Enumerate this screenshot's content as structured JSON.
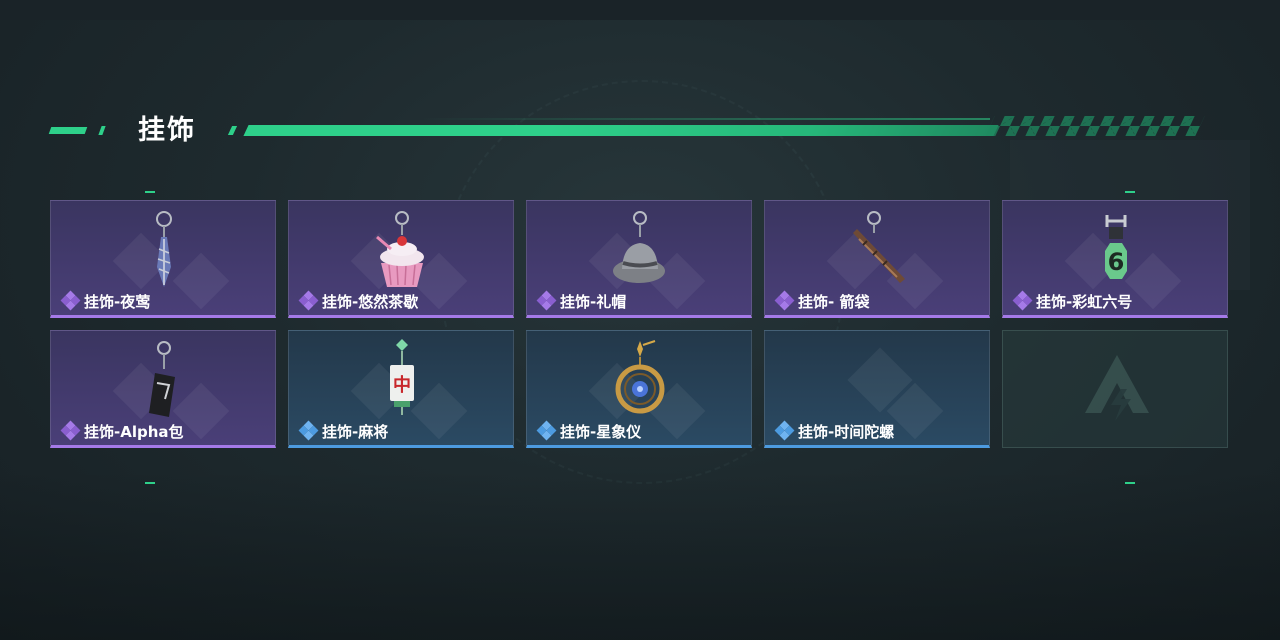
{
  "header": {
    "title": "挂饰"
  },
  "colors": {
    "accent_green": "#2ed08a",
    "rarity_purple": "#a57ae8",
    "rarity_blue": "#4d9be0"
  },
  "items": [
    {
      "name": "挂饰-夜莺",
      "rarity": "purple",
      "icon": "feather-charm-icon"
    },
    {
      "name": "挂饰-悠然茶歇",
      "rarity": "purple",
      "icon": "cupcake-charm-icon"
    },
    {
      "name": "挂饰-礼帽",
      "rarity": "purple",
      "icon": "hat-charm-icon"
    },
    {
      "name": "挂饰- 箭袋",
      "rarity": "purple",
      "icon": "quiver-charm-icon"
    },
    {
      "name": "挂饰-彩虹六号",
      "rarity": "purple",
      "icon": "rainbow-six-charm-icon"
    },
    {
      "name": "挂饰-Alpha包",
      "rarity": "purple",
      "icon": "alpha-pack-charm-icon"
    },
    {
      "name": "挂饰-麻将",
      "rarity": "blue",
      "icon": "mahjong-charm-icon"
    },
    {
      "name": "挂饰-星象仪",
      "rarity": "blue",
      "icon": "astrolabe-charm-icon"
    },
    {
      "name": "挂饰-时间陀螺",
      "rarity": "blue",
      "icon": "spinning-top-icon"
    }
  ],
  "empty_slot": {
    "icon": "game-logo-icon"
  }
}
